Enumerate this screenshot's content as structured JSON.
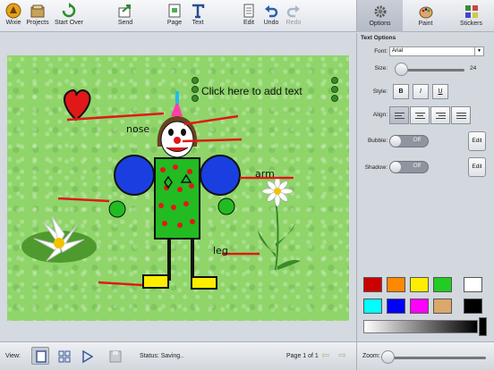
{
  "toolbar": {
    "items": [
      {
        "label": "Wixie",
        "icon": "wixie-logo-icon"
      },
      {
        "label": "Projects",
        "icon": "projects-icon"
      },
      {
        "label": "Start Over",
        "icon": "start-over-icon"
      },
      {
        "label": "Send",
        "icon": "send-icon"
      },
      {
        "label": "Page",
        "icon": "page-icon"
      },
      {
        "label": "Text",
        "icon": "text-icon"
      },
      {
        "label": "Edit",
        "icon": "edit-icon"
      },
      {
        "label": "Undo",
        "icon": "undo-icon"
      },
      {
        "label": "Redo",
        "icon": "redo-icon"
      }
    ]
  },
  "right_tabs": {
    "selected": "Options",
    "items": [
      {
        "label": "Options",
        "icon": "gear-icon"
      },
      {
        "label": "Paint",
        "icon": "palette-icon"
      },
      {
        "label": "Stickers",
        "icon": "stickers-icon"
      }
    ]
  },
  "canvas": {
    "textbox_text": "Click here to add text",
    "labels": {
      "nose": "nose",
      "arm": "arm",
      "leg": "leg"
    }
  },
  "text_options": {
    "header": "Text Options",
    "font_label": "Font:",
    "font_value": "Arial",
    "size_label": "Size:",
    "size_value": "24",
    "style_label": "Style:",
    "style_buttons": [
      "B",
      "I",
      "U"
    ],
    "align_label": "Align:",
    "bubble_label": "Bubble:",
    "bubble_state": "Off",
    "shadow_label": "Shadow:",
    "shadow_state": "Off",
    "edit_label": "Edit",
    "swatches": [
      "#cc0000",
      "#ff8800",
      "#ffee00",
      "#22cc22",
      "#ffffff",
      "#00ffff",
      "#0000ff",
      "#ff00ff",
      "#d9a86a",
      "#000000"
    ]
  },
  "bottom": {
    "view_label": "View:",
    "status_text": "Status:  Saving..",
    "page_text": "Page 1 of 1"
  },
  "zoom": {
    "label": "Zoom:"
  }
}
